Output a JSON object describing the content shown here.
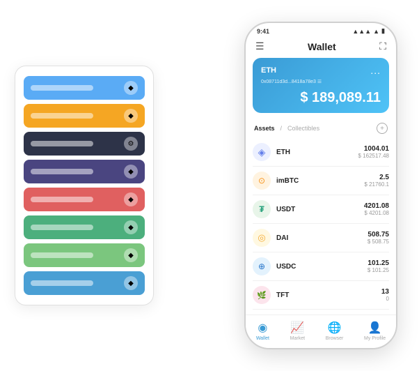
{
  "page": {
    "background": "#ffffff"
  },
  "cardStack": {
    "cards": [
      {
        "color": "card-blue",
        "icon": "◆"
      },
      {
        "color": "card-orange",
        "icon": "◆"
      },
      {
        "color": "card-dark",
        "icon": "⚙"
      },
      {
        "color": "card-purple",
        "icon": "◆"
      },
      {
        "color": "card-red",
        "icon": "◆"
      },
      {
        "color": "card-green",
        "icon": "◆"
      },
      {
        "color": "card-light-green",
        "icon": "◆"
      },
      {
        "color": "card-blue2",
        "icon": "◆"
      }
    ]
  },
  "phone": {
    "statusBar": {
      "time": "9:41",
      "signal": "●●●",
      "wifi": "▲",
      "battery": "▮▮▮"
    },
    "header": {
      "menuIcon": "☰",
      "title": "Wallet",
      "expandIcon": "⛶"
    },
    "ethCard": {
      "label": "ETH",
      "address": "0x08711d3d...8418a78e3 ☰",
      "balance": "$ 189,089.11",
      "dotsMenu": "..."
    },
    "assetsSection": {
      "activeTab": "Assets",
      "slash": "/",
      "inactiveTab": "Collectibles",
      "addBtn": "+"
    },
    "assets": [
      {
        "name": "ETH",
        "icon": "◈",
        "iconBg": "eth-icon",
        "iconColor": "#627EEA",
        "amount": "1004.01",
        "usd": "$ 162517.48"
      },
      {
        "name": "imBTC",
        "icon": "⊙",
        "iconBg": "imbtc-icon",
        "iconColor": "#F7931A",
        "amount": "2.5",
        "usd": "$ 21760.1"
      },
      {
        "name": "USDT",
        "icon": "₮",
        "iconBg": "usdt-icon",
        "iconColor": "#26A17B",
        "amount": "4201.08",
        "usd": "$ 4201.08"
      },
      {
        "name": "DAI",
        "icon": "◎",
        "iconBg": "dai-icon",
        "iconColor": "#F5AC37",
        "amount": "508.75",
        "usd": "$ 508.75"
      },
      {
        "name": "USDC",
        "icon": "⊕",
        "iconBg": "usdc-icon",
        "iconColor": "#2775CA",
        "amount": "101.25",
        "usd": "$ 101.25"
      },
      {
        "name": "TFT",
        "icon": "🌿",
        "iconBg": "tft-icon",
        "iconColor": "#e91e63",
        "amount": "13",
        "usd": "0"
      }
    ],
    "bottomNav": [
      {
        "label": "Wallet",
        "icon": "◉",
        "active": true
      },
      {
        "label": "Market",
        "icon": "📈",
        "active": false
      },
      {
        "label": "Browser",
        "icon": "🌐",
        "active": false
      },
      {
        "label": "My Profile",
        "icon": "👤",
        "active": false
      }
    ]
  }
}
